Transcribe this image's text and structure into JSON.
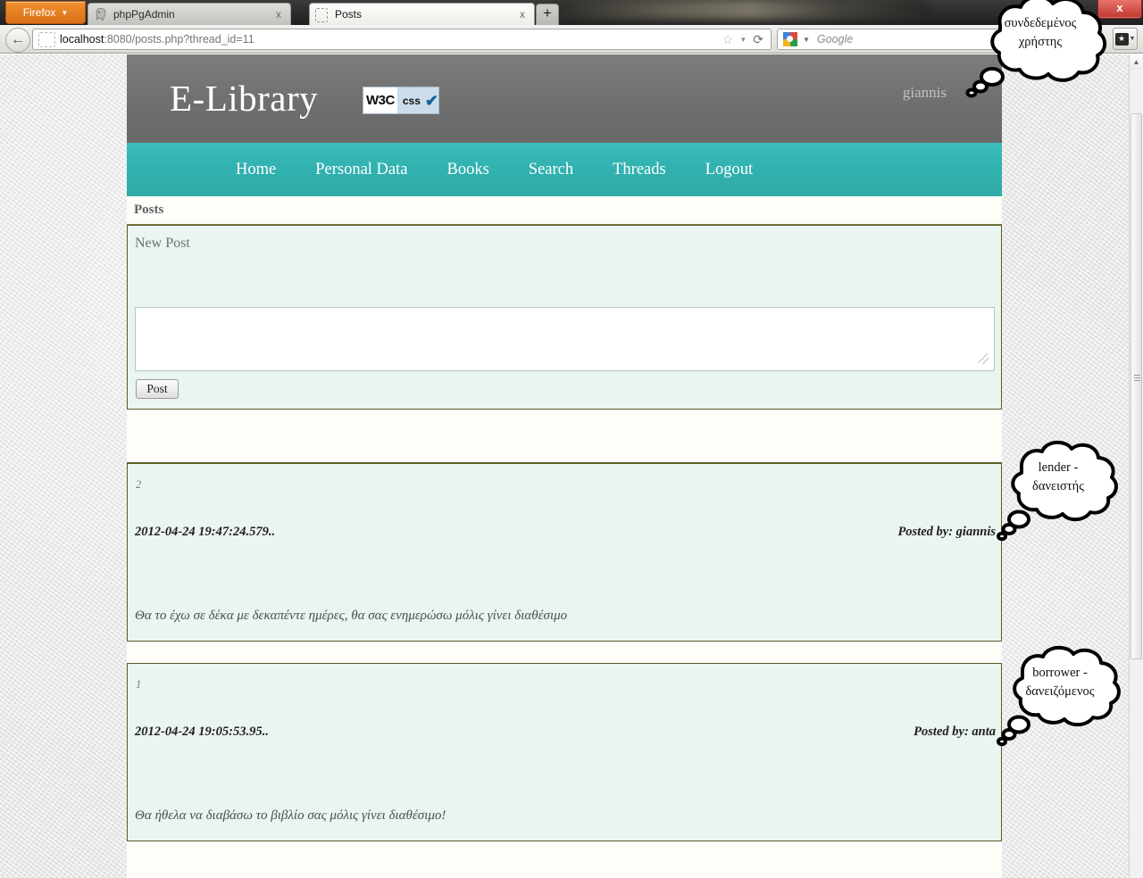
{
  "browser": {
    "app_button": "Firefox",
    "tabs": [
      {
        "title": "phpPgAdmin",
        "favicon": "postgres-elephant-icon",
        "active": false,
        "close_label": "x"
      },
      {
        "title": "Posts",
        "favicon": "blank-page-icon",
        "active": true,
        "close_label": "x"
      }
    ],
    "new_tab_label": "+",
    "window_close_label": "x",
    "back_label": "←",
    "url": {
      "host": "localhost",
      "rest": ":8080/posts.php?thread_id=11"
    },
    "url_full": "localhost:8080/posts.php?thread_id=11",
    "star_label": "☆",
    "dropdown_caret": "▼",
    "reload_label": "⟳",
    "search": {
      "engine": "Google",
      "placeholder": "Google",
      "value": ""
    },
    "bookmarks_button": "★"
  },
  "site": {
    "brand": "E-Library",
    "validator_badge": {
      "w3c": "W3C",
      "kind": "css",
      "check": "✔"
    },
    "logged_in_user": "giannis",
    "nav": [
      {
        "label": "Home"
      },
      {
        "label": "Personal Data"
      },
      {
        "label": "Books"
      },
      {
        "label": "Search"
      },
      {
        "label": "Threads"
      },
      {
        "label": "Logout"
      }
    ],
    "breadcrumb": "Posts",
    "new_post": {
      "label": "New Post",
      "textarea_value": "",
      "textarea_placeholder": "",
      "submit_label": "Post"
    },
    "posts": [
      {
        "id": "2",
        "date": "2012-04-24 19:47:24.579..",
        "author_prefix": "Posted by: ",
        "author": "giannis",
        "author_line": "Posted by: giannis",
        "body": "Θα το έχω σε δέκα με δεκαπέντε ημέρες, θα σας ενημερώσω μόλις γίνει διαθέσιμο"
      },
      {
        "id": "1",
        "date": "2012-04-24 19:05:53.95..",
        "author_prefix": "Posted by: ",
        "author": "anta",
        "author_line": "Posted by: anta",
        "body": "Θα ήθελα να διαβάσω το βιβλίο σας μόλις γίνει διαθέσιμο!"
      }
    ]
  },
  "annotations": [
    {
      "id": "user",
      "line1": "συνδεδεμένος",
      "line2": "χρήστης"
    },
    {
      "id": "lender",
      "line1": "lender -",
      "line2": "δανειστής"
    },
    {
      "id": "borrower",
      "line1": "borrower -",
      "line2": "δανειζόμενος"
    }
  ],
  "colors": {
    "nav_teal": "#31b2b0",
    "header_gray": "#6f6f6f",
    "panel_mint": "#eaf4f1",
    "panel_border": "#5c5a27",
    "page_cream": "#fffdf8",
    "firefox_orange": "#e0821f"
  }
}
